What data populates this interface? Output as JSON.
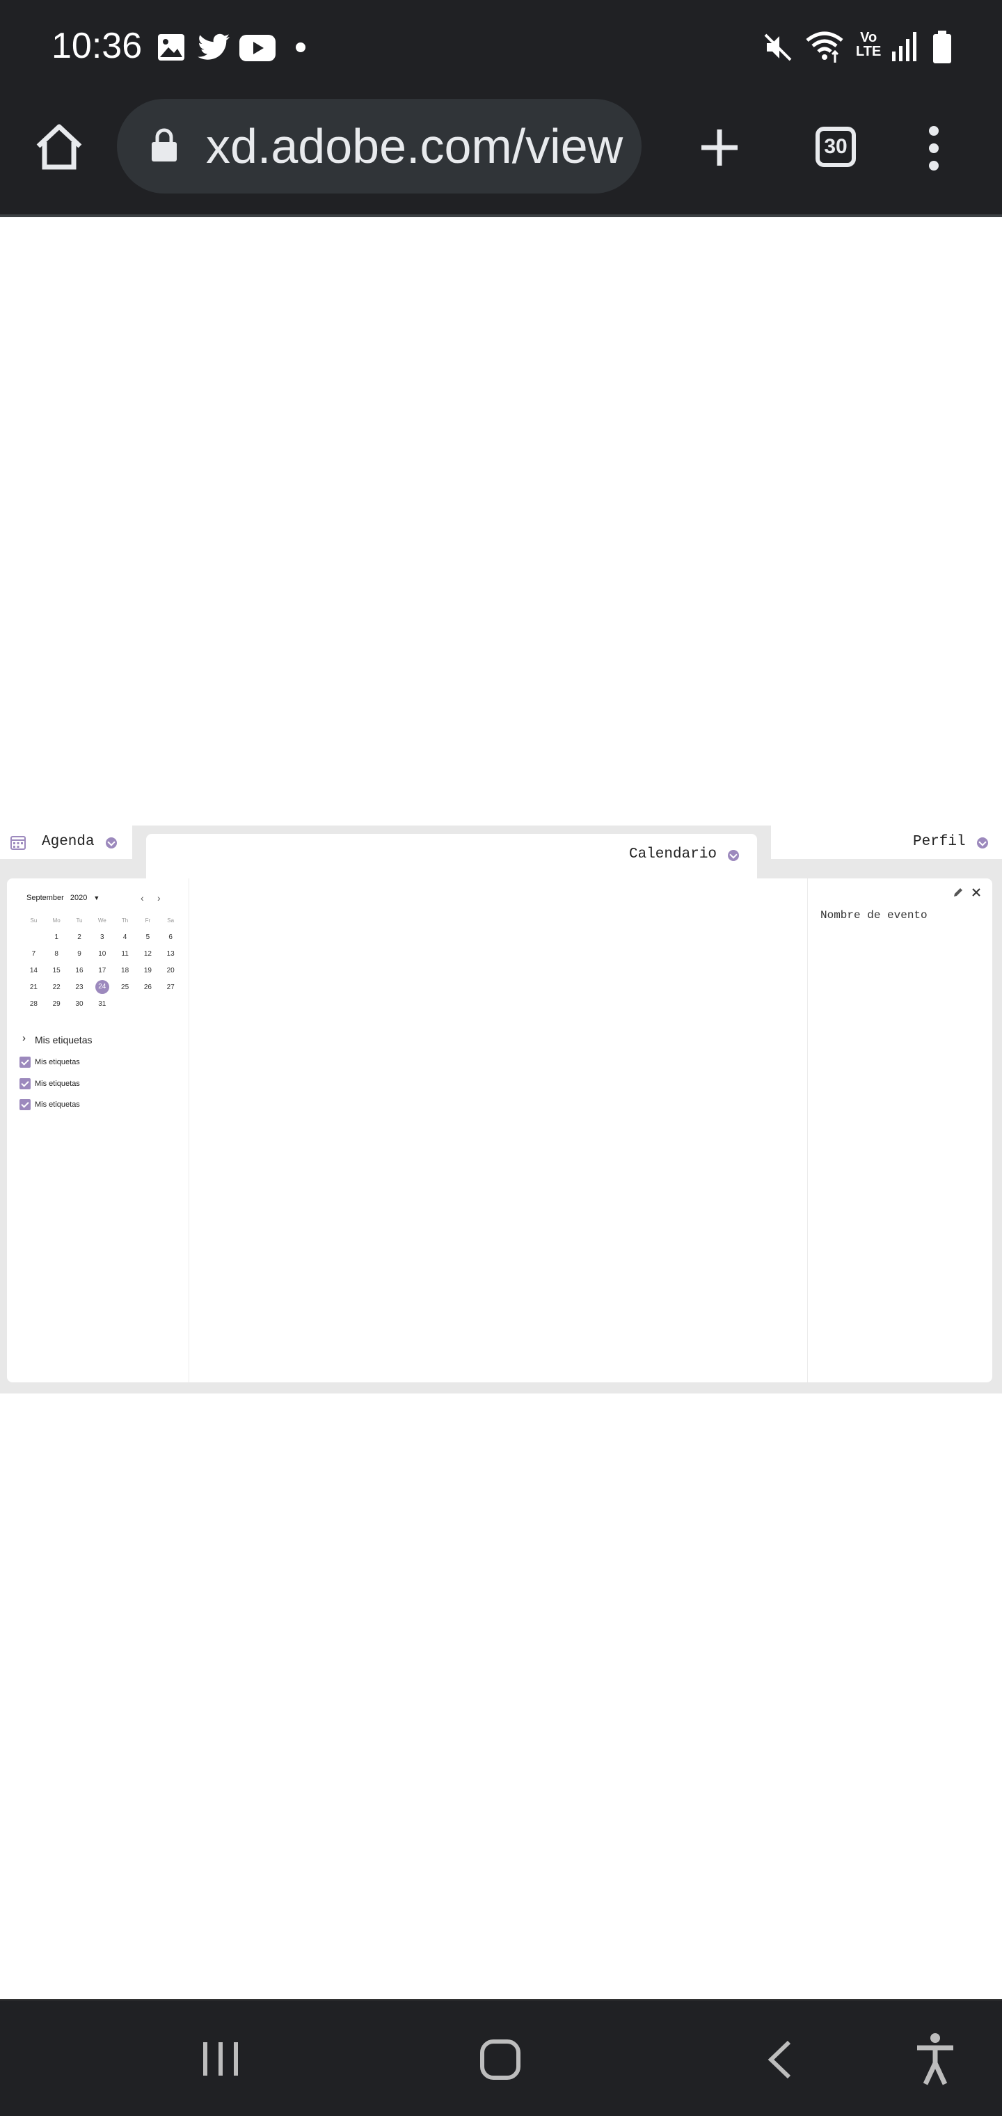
{
  "status_bar": {
    "time": "10:36",
    "icons": [
      "gallery-icon",
      "twitter-icon",
      "youtube-icon",
      "dot-icon",
      "mute-icon",
      "wifi-icon",
      "volte-icon",
      "signal-icon",
      "battery-icon"
    ],
    "volte_top": "Vo",
    "volte_bottom": "LTE"
  },
  "browser": {
    "url": "xd.adobe.com/view",
    "tab_count": "30",
    "icons": [
      "home-icon",
      "lock-icon",
      "new-tab-icon",
      "tabs-icon",
      "menu-icon"
    ]
  },
  "app": {
    "tabs": {
      "agenda": "Agenda",
      "calendario": "Calendario",
      "perfil": "Perfil"
    },
    "calendar": {
      "month": "September",
      "year": "2020",
      "weekdays": [
        "Su",
        "Mo",
        "Tu",
        "We",
        "Th",
        "Fr",
        "Sa"
      ],
      "weeks": [
        [
          "",
          "1",
          "2",
          "3",
          "4",
          "5",
          "6"
        ],
        [
          "7",
          "8",
          "9",
          "10",
          "11",
          "12",
          "13"
        ],
        [
          "14",
          "15",
          "16",
          "17",
          "18",
          "19",
          "20"
        ],
        [
          "21",
          "22",
          "23",
          "24",
          "25",
          "26",
          "27"
        ],
        [
          "28",
          "29",
          "30",
          "31",
          "",
          "",
          ""
        ]
      ],
      "selected": "24"
    },
    "tags": {
      "title": "Mis etiquetas",
      "items": [
        "Mis etiquetas",
        "Mis etiquetas",
        "Mis etiquetas"
      ]
    },
    "event": {
      "name": "Nombre de evento"
    }
  },
  "colors": {
    "accent": "#9c89bd",
    "browser_bg": "#202124",
    "app_bg": "#e8e8e8"
  }
}
